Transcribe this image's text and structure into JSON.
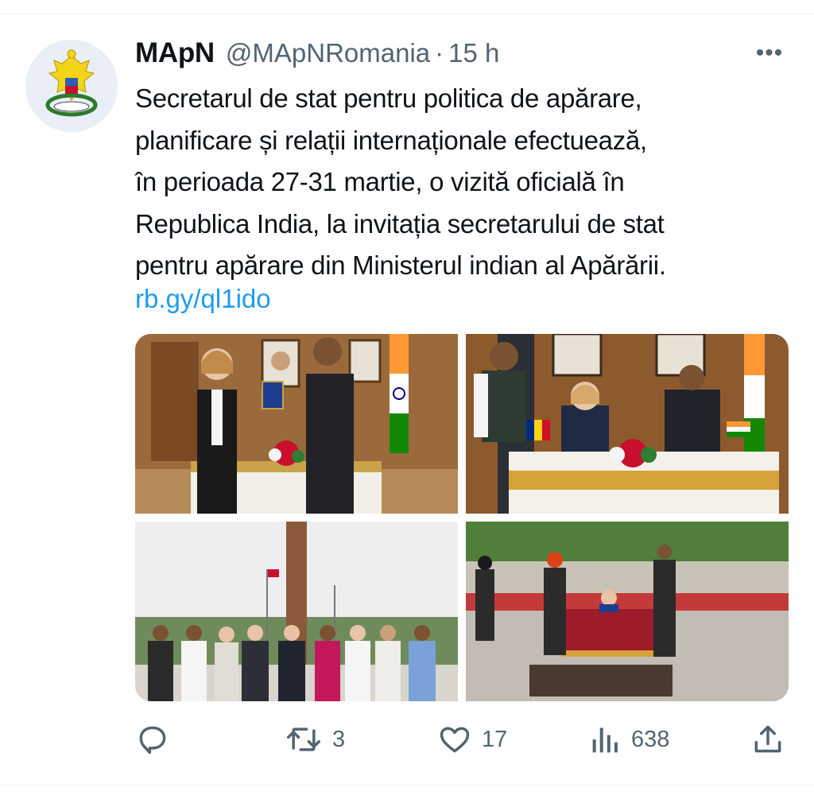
{
  "tweet": {
    "display_name": "MApN",
    "handle": "@MApNRomania",
    "separator": "·",
    "time": "15 h",
    "more_label": "•••",
    "text_lines": [
      "Secretarul de stat pentru politica de apărare,",
      "planificare și relații internaționale efectuează,",
      "în perioada 27-31 martie, o vizită oficială în",
      "Republica India, la invitația secretarului de stat",
      "pentru apărare din Ministerul indian al Apărării."
    ],
    "link": "rb.gy/ql1ido"
  },
  "actions": {
    "reply": {
      "icon": "reply-icon",
      "count": ""
    },
    "retweet": {
      "icon": "retweet-icon",
      "count": "3"
    },
    "like": {
      "icon": "heart-icon",
      "count": "17"
    },
    "views": {
      "icon": "views-icon",
      "count": "638"
    },
    "share": {
      "icon": "share-icon",
      "count": ""
    }
  },
  "colors": {
    "text": "#0f1419",
    "secondary": "#536471",
    "link": "#1d9bf0",
    "divider": "#eff3f4"
  }
}
